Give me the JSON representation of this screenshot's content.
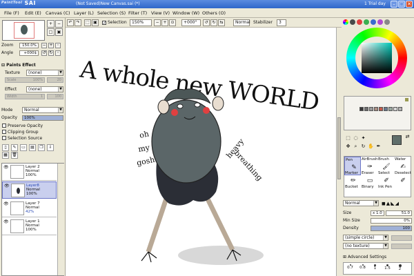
{
  "title_bar": {
    "app_name": "SAI",
    "app_prefix": "PaintTool",
    "document_title": "(Not Saved)New Canvas.sai (*)",
    "trial": "1 Trial day"
  },
  "menu": [
    "File (F)",
    "Edit (E)",
    "Canvas (C)",
    "Layer (L)",
    "Selection (S)",
    "Filter (T)",
    "View (V)",
    "Window (W)",
    "Others (O)"
  ],
  "toolbar": {
    "selection_label": "Selection",
    "zoom": "150%",
    "rotation": "+000°",
    "blend_mode": "Normal",
    "stabilizer_label": "Stabilizer",
    "stabilizer_value": "3"
  },
  "navigator": {
    "zoom_label": "Zoom",
    "zoom_value": "150.0%",
    "angle_label": "Angle",
    "angle_value": "+000$"
  },
  "paints_effect": {
    "section_label": "Paints Effect",
    "texture_label": "Texture",
    "texture_value": "(none)",
    "scale_label": "Scale",
    "scale_value": "100%",
    "scale_num": "20",
    "effect_label": "Effect",
    "effect_value": "(none)",
    "width_label": "Width",
    "width_value": "1",
    "width_num": "100"
  },
  "layer_props": {
    "mode_label": "Mode",
    "mode_value": "Normal",
    "opacity_label": "Opacity",
    "opacity_value": "100%",
    "opacity_fraction": 1.0,
    "preserve_opacity": "Preserve Opacity",
    "clipping_group": "Clipping Group",
    "selection_source": "Selection Source"
  },
  "layers": [
    {
      "name": "Layer 2",
      "mode": "Normal",
      "opacity": "100%",
      "active": false
    },
    {
      "name": "Layer8",
      "mode": "Normal",
      "opacity": "100%",
      "active": true
    },
    {
      "name": "Layer 7",
      "mode": "Normal",
      "opacity": "42%",
      "active": false
    },
    {
      "name": "Layer 1",
      "mode": "Normal",
      "opacity": "100%",
      "active": false
    }
  ],
  "canvas_text": {
    "headline": "A whole new WORLD",
    "left_note": [
      "oh",
      "my",
      "gosh"
    ],
    "right_note": [
      "heavy",
      "breathing"
    ]
  },
  "brushes": [
    [
      "Pen",
      "AirBrush",
      "Brush",
      "Water"
    ],
    [
      "Marker",
      "Eraser",
      "Select",
      "Deselect"
    ],
    [
      "Bucket",
      "Binary",
      "Ink Pen",
      ""
    ]
  ],
  "brush_props": {
    "mode_value": "Normal",
    "size_label": "Size",
    "size_multiplier": "x 1.0",
    "size_value": "51.0",
    "min_size_label": "Min Size",
    "min_size_value": "0%",
    "density_label": "Density",
    "density_value": "100",
    "shape_value": "(simple circle)",
    "texture_value": "(no texture)",
    "advanced_label": "Advanced Settings"
  },
  "brush_sizes": [
    "0.7",
    "0.8",
    "1",
    "1.5",
    "2"
  ],
  "colors": {
    "current": "#5f6e6a",
    "bird_body": "#5b6668",
    "bird_dark": "#2b2e36",
    "legs": "#b9a996",
    "cheeks": "#e04040",
    "accent": "#6a74c6"
  },
  "swatch_colors": [
    "#3a3a3a",
    "#6e6e6e",
    "#9a9a9a",
    "#a88c80",
    "#c45a4a",
    "#6a7a90",
    "#9aa8a0",
    "#d8d8d8",
    "#b2b2b2"
  ]
}
